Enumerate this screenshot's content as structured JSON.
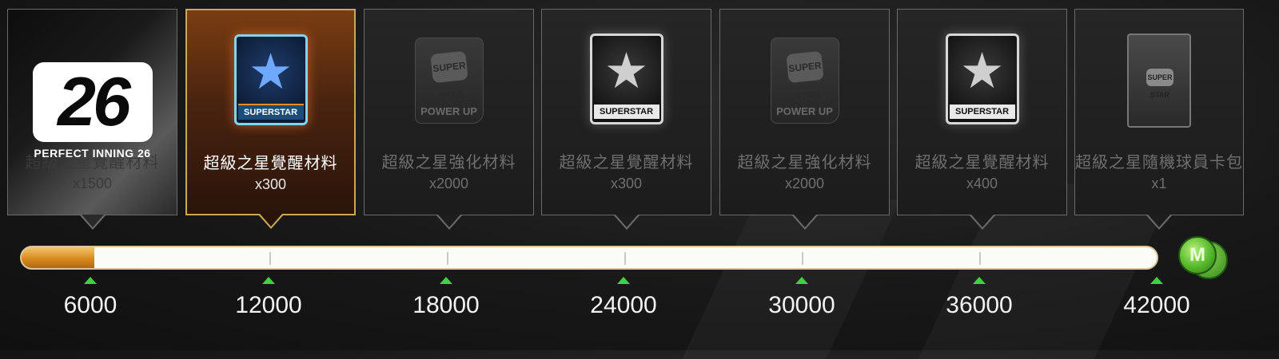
{
  "rewards": [
    {
      "type": "logo",
      "logo_text": "26",
      "caption": "PERFECT INNING 26",
      "name": "超級之星覺醒材料",
      "qty": "x1500"
    },
    {
      "type": "superstar_color",
      "icon_label": "SUPERSTAR",
      "name": "超級之星覺醒材料",
      "qty": "x300",
      "active": true
    },
    {
      "type": "powerup",
      "icon_label": "POWER UP",
      "logo_text": "SUPER STAR",
      "name": "超級之星強化材料",
      "qty": "x2000"
    },
    {
      "type": "superstar",
      "icon_label": "SUPERSTAR",
      "name": "超級之星覺醒材料",
      "qty": "x300"
    },
    {
      "type": "powerup",
      "icon_label": "POWER UP",
      "logo_text": "SUPER STAR",
      "name": "超級之星強化材料",
      "qty": "x2000"
    },
    {
      "type": "superstar",
      "icon_label": "SUPERSTAR",
      "name": "超級之星覺醒材料",
      "qty": "x400"
    },
    {
      "type": "pack",
      "logo_text": "SUPER STAR",
      "name": "超級之星隨機球員卡包",
      "qty": "x1"
    }
  ],
  "progress": {
    "milestones": [
      "6000",
      "12000",
      "18000",
      "24000",
      "30000",
      "36000",
      "42000"
    ],
    "fill_fraction": 0.064,
    "marker_color": "#3fd23f",
    "end_icon": "m-coin-icon",
    "coin_letter": "M"
  },
  "colors": {
    "accent_gold": "#c8a95b",
    "fill_orange": "#d98a1f"
  }
}
